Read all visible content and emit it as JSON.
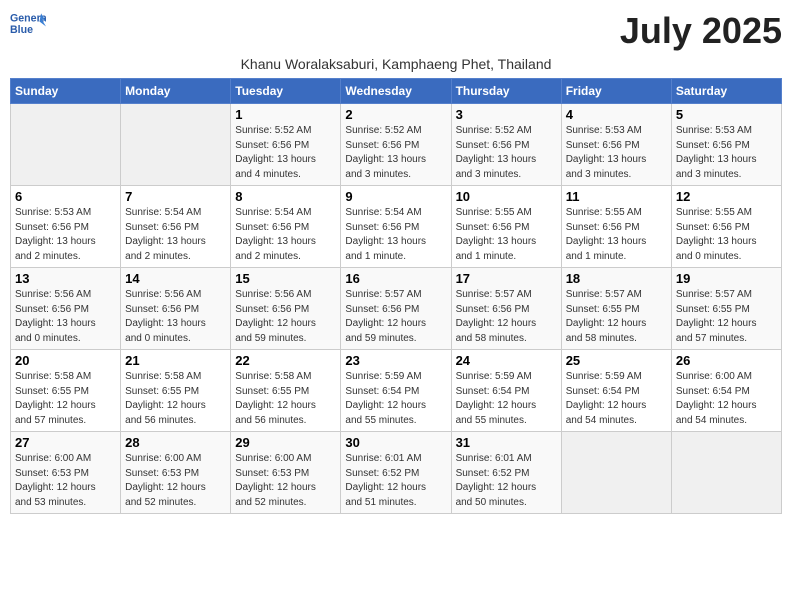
{
  "header": {
    "logo_general": "General",
    "logo_blue": "Blue",
    "title": "July 2025",
    "subtitle": "Khanu Woralaksaburi, Kamphaeng Phet, Thailand"
  },
  "days_of_week": [
    "Sunday",
    "Monday",
    "Tuesday",
    "Wednesday",
    "Thursday",
    "Friday",
    "Saturday"
  ],
  "weeks": [
    [
      {
        "day": "",
        "info": ""
      },
      {
        "day": "",
        "info": ""
      },
      {
        "day": "1",
        "info": "Sunrise: 5:52 AM\nSunset: 6:56 PM\nDaylight: 13 hours\nand 4 minutes."
      },
      {
        "day": "2",
        "info": "Sunrise: 5:52 AM\nSunset: 6:56 PM\nDaylight: 13 hours\nand 3 minutes."
      },
      {
        "day": "3",
        "info": "Sunrise: 5:52 AM\nSunset: 6:56 PM\nDaylight: 13 hours\nand 3 minutes."
      },
      {
        "day": "4",
        "info": "Sunrise: 5:53 AM\nSunset: 6:56 PM\nDaylight: 13 hours\nand 3 minutes."
      },
      {
        "day": "5",
        "info": "Sunrise: 5:53 AM\nSunset: 6:56 PM\nDaylight: 13 hours\nand 3 minutes."
      }
    ],
    [
      {
        "day": "6",
        "info": "Sunrise: 5:53 AM\nSunset: 6:56 PM\nDaylight: 13 hours\nand 2 minutes."
      },
      {
        "day": "7",
        "info": "Sunrise: 5:54 AM\nSunset: 6:56 PM\nDaylight: 13 hours\nand 2 minutes."
      },
      {
        "day": "8",
        "info": "Sunrise: 5:54 AM\nSunset: 6:56 PM\nDaylight: 13 hours\nand 2 minutes."
      },
      {
        "day": "9",
        "info": "Sunrise: 5:54 AM\nSunset: 6:56 PM\nDaylight: 13 hours\nand 1 minute."
      },
      {
        "day": "10",
        "info": "Sunrise: 5:55 AM\nSunset: 6:56 PM\nDaylight: 13 hours\nand 1 minute."
      },
      {
        "day": "11",
        "info": "Sunrise: 5:55 AM\nSunset: 6:56 PM\nDaylight: 13 hours\nand 1 minute."
      },
      {
        "day": "12",
        "info": "Sunrise: 5:55 AM\nSunset: 6:56 PM\nDaylight: 13 hours\nand 0 minutes."
      }
    ],
    [
      {
        "day": "13",
        "info": "Sunrise: 5:56 AM\nSunset: 6:56 PM\nDaylight: 13 hours\nand 0 minutes."
      },
      {
        "day": "14",
        "info": "Sunrise: 5:56 AM\nSunset: 6:56 PM\nDaylight: 13 hours\nand 0 minutes."
      },
      {
        "day": "15",
        "info": "Sunrise: 5:56 AM\nSunset: 6:56 PM\nDaylight: 12 hours\nand 59 minutes."
      },
      {
        "day": "16",
        "info": "Sunrise: 5:57 AM\nSunset: 6:56 PM\nDaylight: 12 hours\nand 59 minutes."
      },
      {
        "day": "17",
        "info": "Sunrise: 5:57 AM\nSunset: 6:56 PM\nDaylight: 12 hours\nand 58 minutes."
      },
      {
        "day": "18",
        "info": "Sunrise: 5:57 AM\nSunset: 6:55 PM\nDaylight: 12 hours\nand 58 minutes."
      },
      {
        "day": "19",
        "info": "Sunrise: 5:57 AM\nSunset: 6:55 PM\nDaylight: 12 hours\nand 57 minutes."
      }
    ],
    [
      {
        "day": "20",
        "info": "Sunrise: 5:58 AM\nSunset: 6:55 PM\nDaylight: 12 hours\nand 57 minutes."
      },
      {
        "day": "21",
        "info": "Sunrise: 5:58 AM\nSunset: 6:55 PM\nDaylight: 12 hours\nand 56 minutes."
      },
      {
        "day": "22",
        "info": "Sunrise: 5:58 AM\nSunset: 6:55 PM\nDaylight: 12 hours\nand 56 minutes."
      },
      {
        "day": "23",
        "info": "Sunrise: 5:59 AM\nSunset: 6:54 PM\nDaylight: 12 hours\nand 55 minutes."
      },
      {
        "day": "24",
        "info": "Sunrise: 5:59 AM\nSunset: 6:54 PM\nDaylight: 12 hours\nand 55 minutes."
      },
      {
        "day": "25",
        "info": "Sunrise: 5:59 AM\nSunset: 6:54 PM\nDaylight: 12 hours\nand 54 minutes."
      },
      {
        "day": "26",
        "info": "Sunrise: 6:00 AM\nSunset: 6:54 PM\nDaylight: 12 hours\nand 54 minutes."
      }
    ],
    [
      {
        "day": "27",
        "info": "Sunrise: 6:00 AM\nSunset: 6:53 PM\nDaylight: 12 hours\nand 53 minutes."
      },
      {
        "day": "28",
        "info": "Sunrise: 6:00 AM\nSunset: 6:53 PM\nDaylight: 12 hours\nand 52 minutes."
      },
      {
        "day": "29",
        "info": "Sunrise: 6:00 AM\nSunset: 6:53 PM\nDaylight: 12 hours\nand 52 minutes."
      },
      {
        "day": "30",
        "info": "Sunrise: 6:01 AM\nSunset: 6:52 PM\nDaylight: 12 hours\nand 51 minutes."
      },
      {
        "day": "31",
        "info": "Sunrise: 6:01 AM\nSunset: 6:52 PM\nDaylight: 12 hours\nand 50 minutes."
      },
      {
        "day": "",
        "info": ""
      },
      {
        "day": "",
        "info": ""
      }
    ]
  ]
}
